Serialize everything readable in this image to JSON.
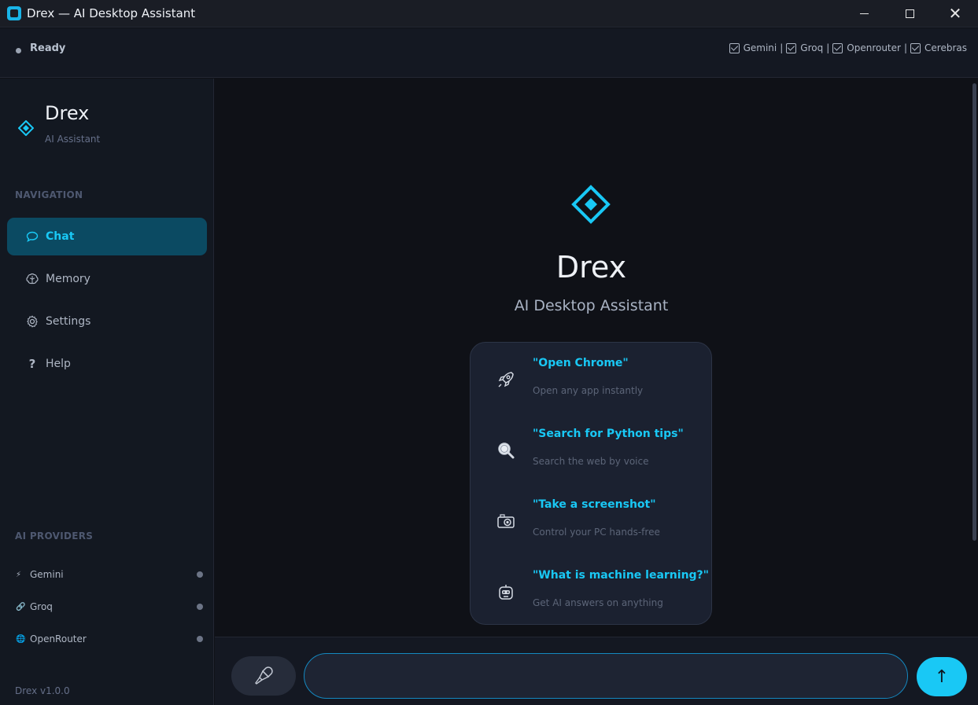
{
  "window": {
    "title": "Drex — AI Desktop Assistant",
    "controls": {
      "minimize": "minimize-icon",
      "maximize": "maximize-icon",
      "close": "close-icon"
    }
  },
  "statusbar": {
    "status": "Ready",
    "providers": [
      "Gemini",
      "Groq",
      "Openrouter",
      "Cerebras"
    ],
    "separator": "|"
  },
  "sidebar": {
    "brand": {
      "name": "Drex",
      "subtitle": "AI Assistant",
      "icon": "diamond-logo-icon"
    },
    "navigation_label": "NAVIGATION",
    "nav_items": [
      {
        "label": "Chat",
        "icon": "chat-bubble-icon",
        "active": true
      },
      {
        "label": "Memory",
        "icon": "brain-icon",
        "active": false
      },
      {
        "label": "Settings",
        "icon": "gear-icon",
        "active": false
      },
      {
        "label": "Help",
        "icon": "question-icon",
        "active": false
      }
    ],
    "providers_label": "AI PROVIDERS",
    "providers": [
      {
        "name": "Gemini",
        "icon": "lightning-icon"
      },
      {
        "name": "Groq",
        "icon": "link-icon"
      },
      {
        "name": "OpenRouter",
        "icon": "globe-icon"
      }
    ],
    "version": "Drex v1.0.0"
  },
  "main": {
    "hero": {
      "title": "Drex",
      "subtitle": "AI Desktop Assistant",
      "icon": "diamond-logo-icon"
    },
    "suggestions": [
      {
        "title": "\"Open Chrome\"",
        "description": "Open any app instantly",
        "icon": "rocket-icon"
      },
      {
        "title": "\"Search for Python tips\"",
        "description": "Search the web by voice",
        "icon": "magnifier-icon"
      },
      {
        "title": "\"Take a screenshot\"",
        "description": "Control your PC hands-free",
        "icon": "camera-icon"
      },
      {
        "title": "\"What is machine learning?\"",
        "description": "Get AI answers on anything",
        "icon": "robot-icon"
      }
    ]
  },
  "inputbar": {
    "placeholder": "",
    "mic_icon": "microphone-icon",
    "send_glyph": "↑"
  },
  "colors": {
    "accent": "#19c8f5",
    "active_nav_bg": "#0b4a62",
    "background": "#0f1117",
    "sidebar_bg": "#131821",
    "card_bg": "#1b2130"
  }
}
